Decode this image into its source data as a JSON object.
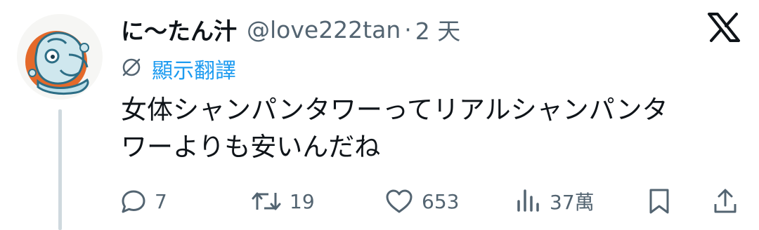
{
  "tweet": {
    "display_name": "に〜たん汁",
    "handle": "@love222tan",
    "separator": "·",
    "time": "2 天",
    "translate_label": "顯示翻譯",
    "text_lines": [
      "女体シャンパンタワーってリアルシャンパンタ",
      "ワーよりも安いんだね"
    ]
  },
  "actions": {
    "reply_count": "7",
    "retweet_count": "19",
    "like_count": "653",
    "views_count": "37萬"
  },
  "icons": {
    "logo": "x-logo-icon",
    "translate": "translate-globe-icon",
    "reply": "reply-bubble-icon",
    "retweet": "retweet-icon",
    "like": "heart-icon",
    "views": "bar-chart-icon",
    "bookmark": "bookmark-icon",
    "share": "share-upload-icon"
  },
  "colors": {
    "text": "#0f1419",
    "muted": "#536471",
    "link": "#1d9bf0",
    "thread_line": "#cfd9de"
  }
}
